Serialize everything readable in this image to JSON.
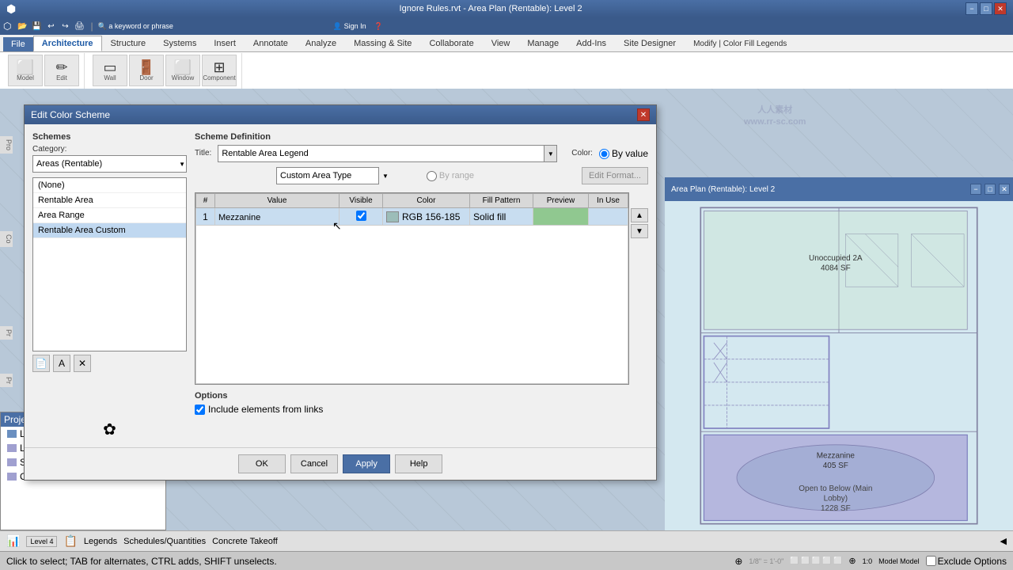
{
  "titlebar": {
    "title": "Ignore Rules.rvt - Area Plan (Rentable): Level 2",
    "min": "−",
    "max": "□",
    "close": "✕"
  },
  "quickaccess": {
    "buttons": [
      "📁",
      "💾",
      "↩",
      "↪",
      "🖨",
      "✂",
      "📋",
      "📐"
    ]
  },
  "tabs": {
    "file": "File",
    "architecture": "Architecture",
    "structure": "Structure",
    "systems": "Systems",
    "insert": "Insert",
    "annotate": "Annotate",
    "analyze": "Analyze",
    "massing_site": "Massing & Site",
    "collaborate": "Collaborate",
    "view": "View",
    "manage": "Manage",
    "addins": "Add-Ins",
    "site_designer": "Site Designer",
    "modify": "Modify | Color Fill Legends",
    "active": "Architecture"
  },
  "dialog": {
    "title": "Edit Color Scheme",
    "schemes_section": "Schemes",
    "category_label": "Category:",
    "category_value": "Areas (Rentable)",
    "scheme_def_label": "Scheme Definition",
    "title_label": "Title:",
    "title_value": "Rentable Area Legend",
    "color_label": "Color:",
    "color_value": "Custom Area Type",
    "by_value_label": "By value",
    "by_range_label": "By range",
    "edit_format_label": "Edit Format...",
    "schemes_list": [
      {
        "id": 1,
        "name": "(None)",
        "selected": false
      },
      {
        "id": 2,
        "name": "Rentable Area",
        "selected": false
      },
      {
        "id": 3,
        "name": "Area Range",
        "selected": false
      },
      {
        "id": 4,
        "name": "Rentable Area Custom",
        "selected": false
      }
    ],
    "table": {
      "columns": [
        "Value",
        "Visible",
        "Color",
        "Fill Pattern",
        "Preview",
        "In Use"
      ],
      "rows": [
        {
          "num": "1",
          "value": "Mezzanine",
          "visible": true,
          "color": "RGB 156-185",
          "fill_pattern": "Solid fill",
          "preview_color": "#90c890",
          "in_use": ""
        }
      ]
    },
    "options_label": "Options",
    "include_elements_label": "Include elements from links",
    "include_elements_checked": true,
    "ok_label": "OK",
    "cancel_label": "Cancel",
    "apply_label": "Apply",
    "help_label": "Help"
  },
  "floor_plan": {
    "unoccupied_label": "Unoccupied 2A",
    "unoccupied_sf": "4084 SF",
    "mezzanine_label": "Mezzanine",
    "mezzanine_sf": "405 SF",
    "open_to_below_label": "Open to Below (Main Lobby)",
    "open_to_below_sf": "1228 SF"
  },
  "statusbar": {
    "message": "Click to select; TAB for alternates, CTRL adds, SHIFT unselects.",
    "scale": "1/8\" = 1'-0\"",
    "model_mode": "Model Model",
    "exclude_options": "Exclude Options"
  },
  "project_browser": {
    "title": "Project Browser",
    "items": [
      {
        "label": "Level 4"
      },
      {
        "label": "Legends"
      },
      {
        "label": "Schedules/Quantities"
      },
      {
        "label": "Concrete Takeoff"
      }
    ]
  }
}
